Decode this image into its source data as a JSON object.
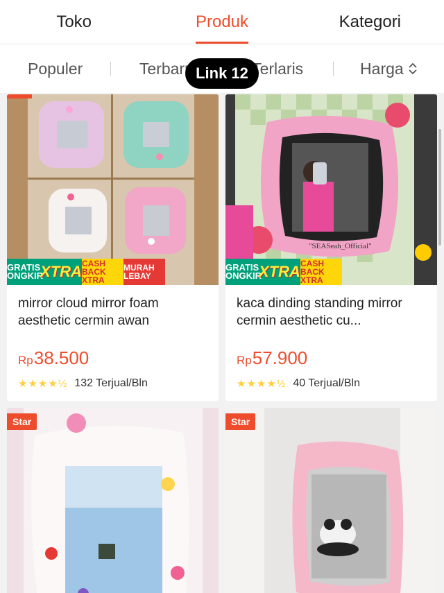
{
  "tabs": [
    {
      "label": "Toko"
    },
    {
      "label": "Produk"
    },
    {
      "label": "Kategori"
    }
  ],
  "sort": {
    "populer": "Populer",
    "terbaru": "Terbaru",
    "terlaris": "Terlaris",
    "harga": "Harga"
  },
  "overlay": {
    "link_label": "Link 12"
  },
  "badges": {
    "gratis": "GRATIS ONGKIR",
    "xtra": "XTRA",
    "cashback": "CASH BACK XTRA",
    "murah": "MURAH LEBAY",
    "star": "Star"
  },
  "products": [
    {
      "title": "mirror cloud mirror foam aesthetic cermin awan",
      "currency": "Rp",
      "price": "38.500",
      "sold": "132 Terjual/Bln",
      "rating": 4.5
    },
    {
      "title": "kaca dinding standing mirror cermin aesthetic cu...",
      "currency": "Rp",
      "price": "57.900",
      "sold": "40 Terjual/Bln",
      "rating": 4.5,
      "photo_caption": "\"SEASeah_Official\""
    },
    {
      "title": "",
      "currency": "",
      "price": "",
      "sold": ""
    },
    {
      "title": "",
      "currency": "",
      "price": "",
      "sold": ""
    }
  ]
}
